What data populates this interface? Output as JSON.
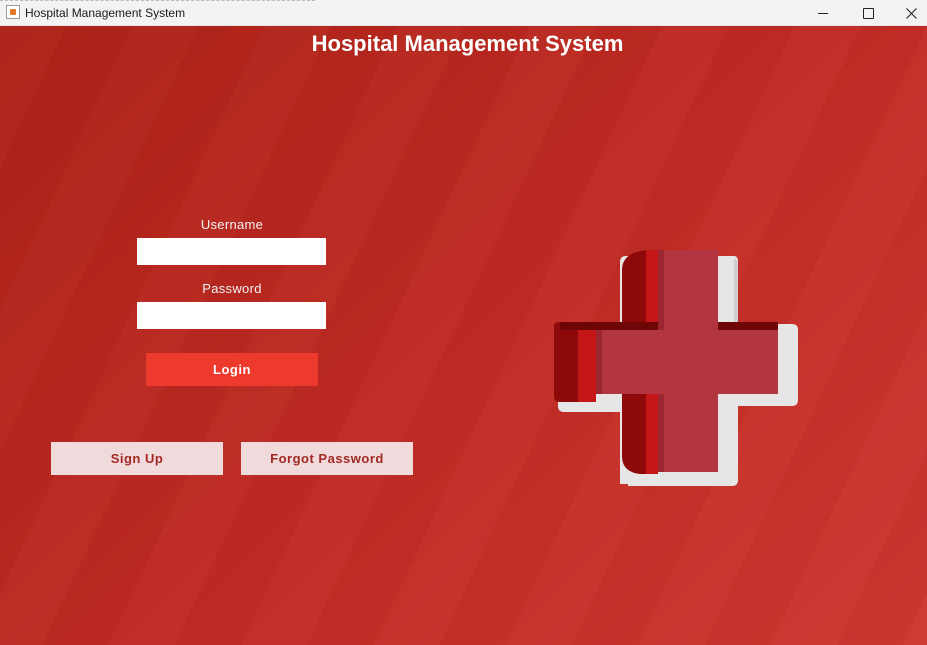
{
  "window": {
    "title": "Hospital Management System",
    "controls": [
      "minimize",
      "maximize",
      "close"
    ]
  },
  "app": {
    "title": "Hospital Management System"
  },
  "form": {
    "username_label": "Username",
    "username_value": "",
    "password_label": "Password",
    "password_value": "",
    "login_label": "Login"
  },
  "actions": {
    "signup_label": "Sign Up",
    "forgot_label": "Forgot Password"
  },
  "colors": {
    "background": "#bd2a22",
    "login_button": "#ee3a2c",
    "secondary_button": "#f1dadb",
    "cross": "#b3353f"
  },
  "icons": {
    "logo": "red-cross-icon",
    "app": "java-app-icon"
  }
}
